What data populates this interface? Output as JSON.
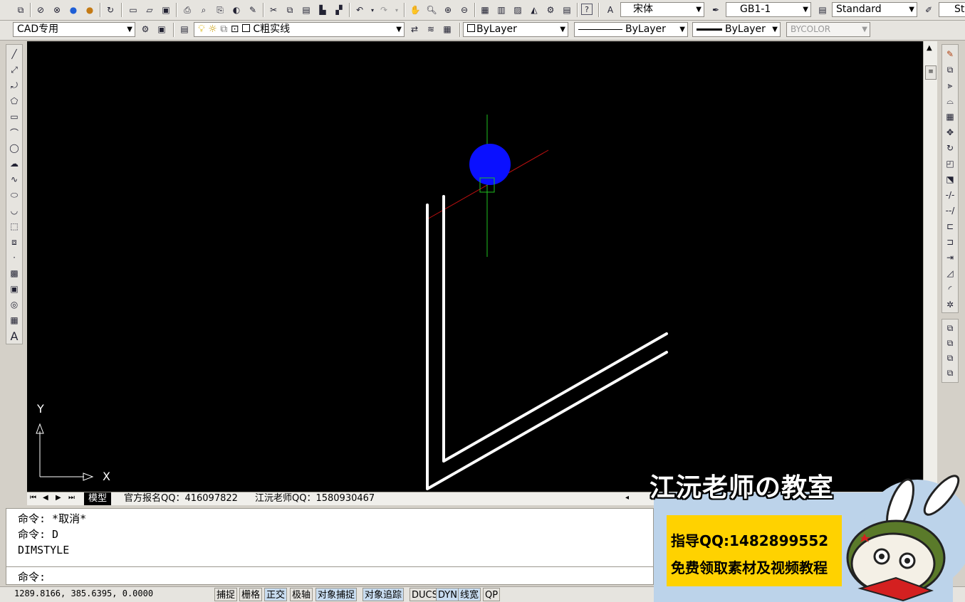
{
  "toolbar1": {
    "text_style_font": "宋体",
    "text_style": "GB1-1",
    "dim_style": "Standard",
    "truncated_combo": "St"
  },
  "toolbar2": {
    "workspace": "CAD专用",
    "layer": "C粗实线",
    "color": "ByLayer",
    "linetype": "ByLayer",
    "lineweight": "ByLayer",
    "plotstyle": "BYCOLOR"
  },
  "drawing": {
    "ucs_x_label": "X",
    "ucs_y_label": "Y"
  },
  "tabs": {
    "model": "模型",
    "layout1": "官方报名QQ：416097822",
    "layout2": "江沅老师QQ：1580930467"
  },
  "command": {
    "history": [
      "命令: *取消*",
      "命令: D",
      "DIMSTYLE"
    ],
    "prompt": "命令:"
  },
  "status": {
    "coords": "1289.8166, 385.6395, 0.0000",
    "buttons": [
      {
        "label": "捕捉",
        "on": false
      },
      {
        "label": "栅格",
        "on": false
      },
      {
        "label": "正交",
        "on": true
      },
      {
        "label": "极轴",
        "on": false
      },
      {
        "label": "对象捕捉",
        "on": true
      },
      {
        "label": "对象追踪",
        "on": true
      },
      {
        "label": "DUCS",
        "on": false
      },
      {
        "label": "DYN",
        "on": true
      },
      {
        "label": "线宽",
        "on": true
      },
      {
        "label": "QP",
        "on": false
      }
    ]
  },
  "ad": {
    "title": "江沅老师の教室",
    "qq": "指导QQ:1482899552",
    "tagline": "免费领取素材及视频教程"
  },
  "colors": {
    "canvas": "#000000",
    "cursor_circle": "#0a10ff",
    "status_on": "#c8dcf0",
    "ad_yellow": "#ffd200",
    "ad_blue": "#bcd3ea"
  }
}
